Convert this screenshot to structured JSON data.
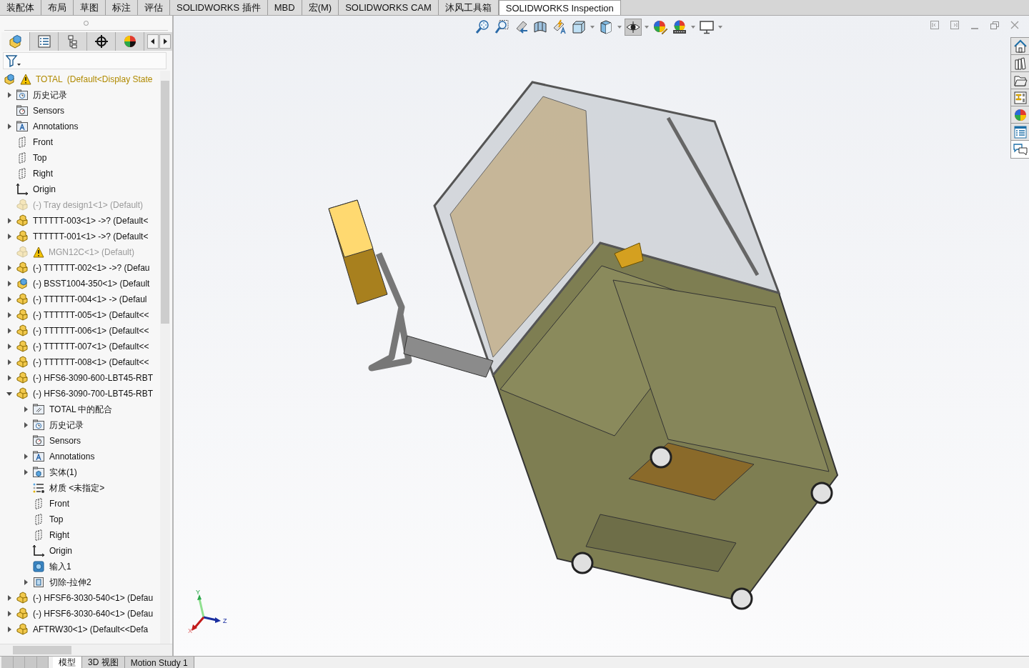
{
  "command_tabs": [
    {
      "label": "装配体",
      "selected": false
    },
    {
      "label": "布局",
      "selected": false
    },
    {
      "label": "草图",
      "selected": false
    },
    {
      "label": "标注",
      "selected": false
    },
    {
      "label": "评估",
      "selected": false
    },
    {
      "label": "SOLIDWORKS 插件",
      "selected": false
    },
    {
      "label": "MBD",
      "selected": false
    },
    {
      "label": "宏(M)",
      "selected": false
    },
    {
      "label": "SOLIDWORKS CAM",
      "selected": false
    },
    {
      "label": "沐风工具箱",
      "selected": false
    },
    {
      "label": "SOLIDWORKS Inspection",
      "selected": true
    }
  ],
  "panel_tabs": [
    {
      "kind": "tree",
      "selected": true
    },
    {
      "kind": "properties",
      "selected": false
    },
    {
      "kind": "configurations",
      "selected": false
    },
    {
      "kind": "dimxpert",
      "selected": false
    },
    {
      "kind": "display",
      "selected": false
    }
  ],
  "feature_tree": {
    "root": {
      "label": "TOTAL  (Default<Display State",
      "kind": "assembly",
      "warning": true,
      "suppressed": false,
      "children": [
        {
          "label": "历史记录",
          "kind": "history",
          "expanded": false,
          "warning": false,
          "suppressed": false
        },
        {
          "label": "Sensors",
          "kind": "sensors",
          "warning": false,
          "suppressed": false
        },
        {
          "label": "Annotations",
          "kind": "annotations",
          "expanded": false,
          "warning": false,
          "suppressed": false
        },
        {
          "label": "Front",
          "kind": "plane",
          "warning": false,
          "suppressed": false
        },
        {
          "label": "Top",
          "kind": "plane",
          "warning": false,
          "suppressed": false
        },
        {
          "label": "Right",
          "kind": "plane",
          "warning": false,
          "suppressed": false
        },
        {
          "label": "Origin",
          "kind": "origin",
          "warning": false,
          "suppressed": false
        },
        {
          "label": "(-) Tray design1<1> (Default)",
          "kind": "part",
          "warning": false,
          "suppressed": true
        },
        {
          "label": "TTTTTT-003<1> ->? (Default<",
          "kind": "part",
          "expanded": false,
          "warning": false,
          "suppressed": false
        },
        {
          "label": "TTTTTT-001<1> ->? (Default<",
          "kind": "part",
          "expanded": false,
          "warning": false,
          "suppressed": false
        },
        {
          "label": "MGN12C<1> (Default)",
          "kind": "part",
          "warning": true,
          "suppressed": true
        },
        {
          "label": "(-) TTTTTT-002<1> ->? (Defau",
          "kind": "part",
          "expanded": false,
          "warning": false,
          "suppressed": false
        },
        {
          "label": "(-) BSST1004-350<1> (Default",
          "kind": "assembly",
          "expanded": false,
          "warning": false,
          "suppressed": false
        },
        {
          "label": "(-) TTTTTT-004<1> -> (Defaul",
          "kind": "part",
          "expanded": false,
          "warning": false,
          "suppressed": false
        },
        {
          "label": "(-) TTTTTT-005<1> (Default<<",
          "kind": "part",
          "expanded": false,
          "warning": false,
          "suppressed": false
        },
        {
          "label": "(-) TTTTTT-006<1> (Default<<",
          "kind": "part",
          "expanded": false,
          "warning": false,
          "suppressed": false
        },
        {
          "label": "(-) TTTTTT-007<1> (Default<<",
          "kind": "part",
          "expanded": false,
          "warning": false,
          "suppressed": false
        },
        {
          "label": "(-) TTTTTT-008<1> (Default<<",
          "kind": "part",
          "expanded": false,
          "warning": false,
          "suppressed": false
        },
        {
          "label": "(-) HFS6-3090-600-LBT45-RBT",
          "kind": "part",
          "expanded": false,
          "warning": false,
          "suppressed": false
        },
        {
          "label": "(-) HFS6-3090-700-LBT45-RBT",
          "kind": "part",
          "expanded": true,
          "warning": false,
          "suppressed": false,
          "children": [
            {
              "label": "TOTAL 中的配合",
              "kind": "mates",
              "expanded": false,
              "warning": false,
              "suppressed": false
            },
            {
              "label": "历史记录",
              "kind": "history",
              "expanded": false,
              "warning": false,
              "suppressed": false
            },
            {
              "label": "Sensors",
              "kind": "sensors",
              "warning": false,
              "suppressed": false
            },
            {
              "label": "Annotations",
              "kind": "annotations",
              "expanded": false,
              "warning": false,
              "suppressed": false
            },
            {
              "label": "实体(1)",
              "kind": "solid",
              "expanded": false,
              "warning": false,
              "suppressed": false
            },
            {
              "label": "材质 <未指定>",
              "kind": "material",
              "warning": false,
              "suppressed": false
            },
            {
              "label": "Front",
              "kind": "plane",
              "warning": false,
              "suppressed": false
            },
            {
              "label": "Top",
              "kind": "plane",
              "warning": false,
              "suppressed": false
            },
            {
              "label": "Right",
              "kind": "plane",
              "warning": false,
              "suppressed": false
            },
            {
              "label": "Origin",
              "kind": "origin",
              "warning": false,
              "suppressed": false
            },
            {
              "label": "输入1",
              "kind": "import",
              "warning": false,
              "suppressed": false
            },
            {
              "label": "切除-拉伸2",
              "kind": "cut",
              "expanded": false,
              "warning": false,
              "suppressed": false
            }
          ]
        },
        {
          "label": "(-) HFSF6-3030-540<1> (Defau",
          "kind": "part",
          "expanded": false,
          "warning": false,
          "suppressed": false
        },
        {
          "label": "(-) HFSF6-3030-640<1> (Defau",
          "kind": "part",
          "expanded": false,
          "warning": false,
          "suppressed": false
        },
        {
          "label": "AFTRW30<1> (Default<<Defa",
          "kind": "part",
          "expanded": false,
          "warning": false,
          "suppressed": false
        }
      ]
    }
  },
  "view_toolbar": [
    {
      "kind": "zoom-fit",
      "pressed": false
    },
    {
      "kind": "zoom-area",
      "pressed": false
    },
    {
      "kind": "previous-view",
      "pressed": false
    },
    {
      "kind": "section",
      "pressed": false
    },
    {
      "kind": "annotation",
      "pressed": false
    },
    {
      "kind": "orientation",
      "pressed": false,
      "menu": true
    },
    {
      "kind": "display-style",
      "pressed": false,
      "menu": true
    },
    {
      "kind": "hide-show",
      "pressed": true,
      "menu": true
    },
    {
      "kind": "appearance",
      "pressed": false
    },
    {
      "kind": "scene",
      "pressed": false,
      "menu": true
    },
    {
      "kind": "view-settings",
      "pressed": false,
      "menu": true
    }
  ],
  "task_pane": [
    {
      "kind": "home",
      "selected": false
    },
    {
      "kind": "library",
      "selected": false
    },
    {
      "kind": "explorer",
      "selected": false
    },
    {
      "kind": "palette",
      "selected": false
    },
    {
      "kind": "appearances",
      "selected": false
    },
    {
      "kind": "properties",
      "selected": false
    },
    {
      "kind": "forum",
      "selected": true
    }
  ],
  "triad": {
    "y_label": "Y",
    "z_label": "Z",
    "x_label": "X"
  },
  "bottom_tabs": [
    {
      "label": "模型",
      "selected": true
    },
    {
      "label": "3D 视图",
      "selected": false
    },
    {
      "label": "Motion Study 1",
      "selected": false
    }
  ]
}
